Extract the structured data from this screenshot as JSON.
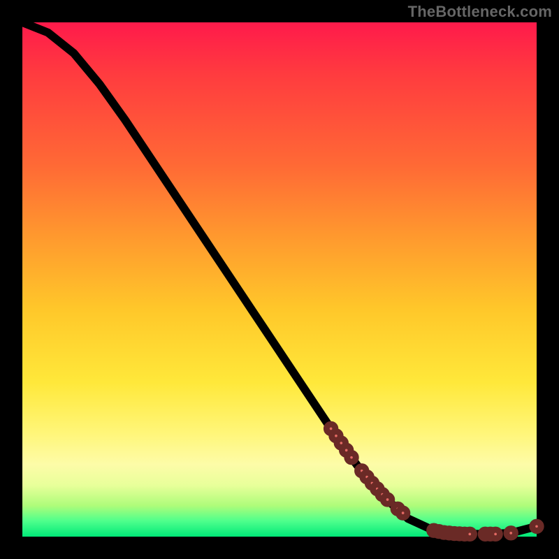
{
  "watermark": "TheBottleneck.com",
  "colors": {
    "black": "#000000",
    "marker_fill": "#e46a64",
    "marker_stroke": "#6a2a26",
    "gradient_stops": [
      "#ff1a4b",
      "#ff6a35",
      "#ffc82a",
      "#fff67a",
      "#4dff8c",
      "#00e878"
    ]
  },
  "chart_data": {
    "type": "line",
    "title": "",
    "xlabel": "",
    "ylabel": "",
    "xlim": [
      0,
      100
    ],
    "ylim": [
      0,
      100
    ],
    "series": [
      {
        "name": "curve",
        "x": [
          0,
          5,
          10,
          15,
          20,
          25,
          30,
          35,
          40,
          45,
          50,
          55,
          60,
          65,
          70,
          75,
          80,
          85,
          90,
          95,
          100
        ],
        "values": [
          100,
          98,
          94,
          88,
          81,
          73.5,
          66,
          58.5,
          51,
          43.5,
          36,
          28.5,
          21,
          14,
          8,
          3.5,
          1.2,
          0.5,
          0.5,
          0.7,
          2
        ]
      }
    ],
    "markers": {
      "name": "segment-points",
      "x": [
        60,
        61,
        62,
        63,
        64,
        66,
        67,
        68,
        69,
        70,
        71,
        73,
        74,
        80,
        81,
        82,
        83,
        84,
        85,
        86,
        87,
        90,
        91,
        92,
        95,
        100
      ],
      "values": [
        21,
        19.6,
        18.2,
        16.8,
        15.4,
        12.8,
        11.6,
        10.4,
        9.3,
        8.2,
        7.2,
        5.4,
        4.6,
        1.2,
        1.0,
        0.8,
        0.7,
        0.6,
        0.55,
        0.5,
        0.5,
        0.5,
        0.5,
        0.5,
        0.7,
        2
      ]
    }
  }
}
